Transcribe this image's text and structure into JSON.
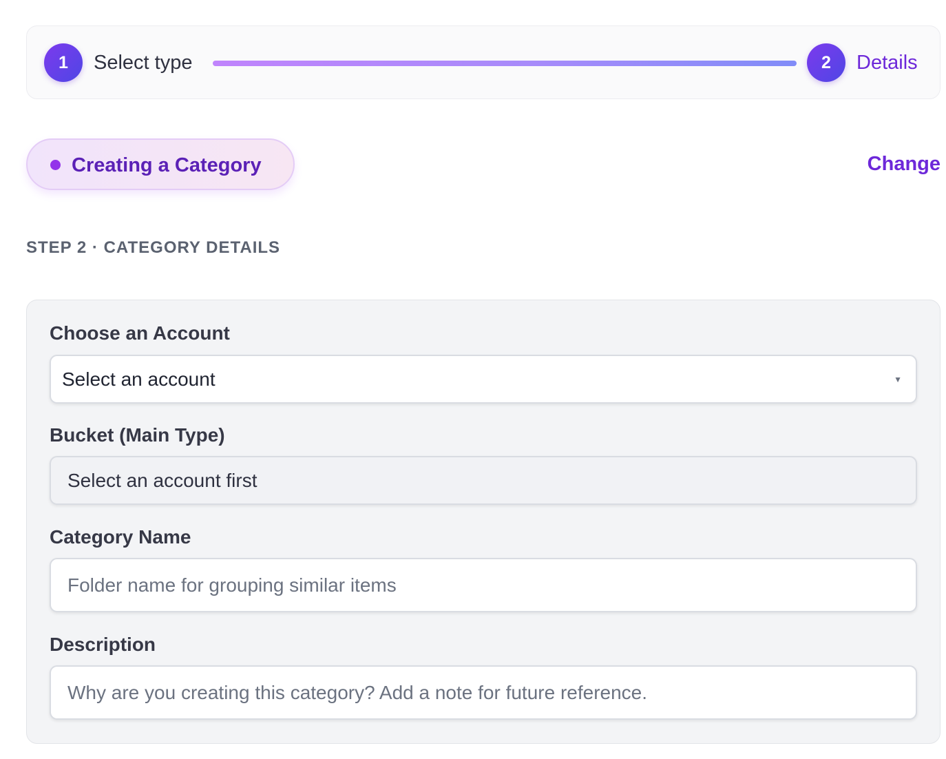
{
  "stepper": {
    "step1": {
      "number": "1",
      "label": "Select type"
    },
    "step2": {
      "number": "2",
      "label": "Details"
    }
  },
  "type_pill": {
    "label": "Creating a Category"
  },
  "change_link": "Change",
  "step_heading": "STEP 2 · CATEGORY DETAILS",
  "form": {
    "account": {
      "label": "Choose an Account",
      "value": "Select an account"
    },
    "bucket": {
      "label": "Bucket (Main Type)",
      "value": "Select an account first"
    },
    "category_name": {
      "label": "Category Name",
      "placeholder": "Folder name for grouping similar items"
    },
    "description": {
      "label": "Description",
      "placeholder": "Why are you creating this category? Add a note for future reference."
    }
  },
  "colors": {
    "accent": "#6d28d9",
    "pill_text": "#5b21b6",
    "progress_start": "#c084fc",
    "progress_end": "#818cf8"
  }
}
